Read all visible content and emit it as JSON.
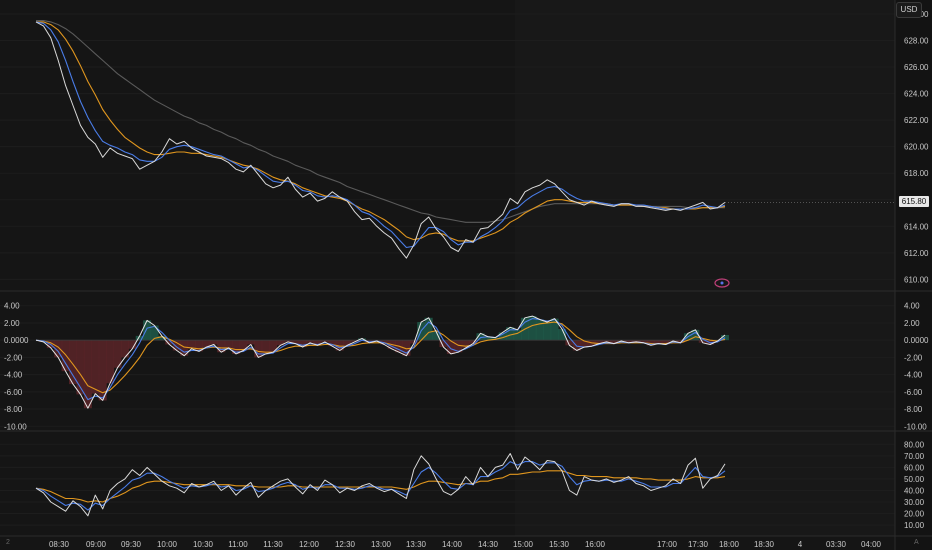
{
  "header": {
    "currency_label": "USD",
    "last_price_label": "615.80",
    "main_title": "",
    "osc1_title": "",
    "osc2_title": ""
  },
  "chart_data": [
    {
      "type": "line",
      "panel": "price",
      "title": "",
      "y_ticks": [
        "630.00",
        "628.00",
        "626.00",
        "624.00",
        "622.00",
        "620.00",
        "618.00",
        "616.00",
        "614.00",
        "612.00",
        "610.00"
      ],
      "ylim": [
        609.5,
        630.6
      ],
      "x_ticks": [
        "08:30",
        "09:00",
        "09:30",
        "10:00",
        "10:30",
        "11:00",
        "11:30",
        "12:00",
        "12:30",
        "13:00",
        "13:30",
        "14:00",
        "14:30",
        "15:00",
        "15:30",
        "16:00",
        "17:00",
        "17:30",
        "18:00",
        "18:30",
        "4",
        "03:30",
        "04:00"
      ],
      "last_price": 615.8,
      "series": [
        {
          "key": "price",
          "color": "#d9d9d9",
          "y": [
            629.4,
            629.1,
            628.2,
            626.5,
            624.6,
            623.1,
            621.6,
            620.7,
            620.2,
            619.2,
            619.9,
            619.5,
            619.3,
            619.1,
            618.3,
            618.6,
            618.9,
            619.6,
            620.6,
            620.2,
            620.4,
            619.9,
            619.6,
            619.3,
            619.2,
            619.1,
            618.8,
            618.3,
            618.1,
            618.6,
            617.9,
            617.2,
            616.9,
            617.1,
            617.7,
            616.8,
            616.2,
            616.5,
            615.9,
            616.1,
            616.6,
            616.2,
            615.9,
            615.1,
            614.5,
            614.6,
            614.0,
            613.5,
            613.1,
            612.3,
            611.6,
            612.6,
            614.2,
            614.7,
            613.8,
            613.2,
            612.4,
            612.1,
            613.0,
            612.8,
            613.8,
            613.9,
            614.4,
            614.9,
            616.1,
            615.7,
            616.6,
            616.9,
            617.1,
            617.5,
            617.2,
            616.6,
            616.0,
            615.8,
            615.6,
            615.9,
            615.7,
            615.6,
            615.5,
            615.7,
            615.7,
            615.5,
            615.5,
            615.4,
            615.3,
            615.2,
            615.3,
            615.2,
            615.4,
            615.6,
            615.8,
            615.3,
            615.4,
            615.8
          ]
        },
        {
          "key": "ema-fast",
          "color": "#4a7de8",
          "y": [
            629.4,
            629.3,
            628.8,
            627.9,
            626.5,
            624.9,
            623.4,
            622.2,
            621.2,
            620.4,
            620.1,
            619.9,
            619.6,
            619.4,
            619.0,
            618.9,
            618.9,
            619.2,
            619.8,
            620.0,
            620.1,
            620.0,
            619.8,
            619.6,
            619.4,
            619.3,
            619.0,
            618.7,
            618.4,
            618.5,
            618.2,
            617.8,
            617.4,
            617.3,
            617.4,
            617.1,
            616.7,
            616.6,
            616.3,
            616.2,
            616.3,
            616.2,
            616.0,
            615.6,
            615.1,
            614.9,
            614.5,
            614.0,
            613.6,
            613.0,
            612.4,
            612.5,
            613.2,
            613.9,
            613.9,
            613.6,
            613.0,
            612.6,
            612.8,
            612.8,
            613.2,
            613.5,
            613.9,
            614.4,
            615.2,
            615.4,
            615.9,
            616.3,
            616.6,
            616.9,
            617.0,
            616.8,
            616.4,
            616.1,
            615.9,
            615.9,
            615.8,
            615.7,
            615.6,
            615.7,
            615.7,
            615.6,
            615.6,
            615.5,
            615.4,
            615.3,
            615.3,
            615.3,
            615.3,
            615.4,
            615.6,
            615.5,
            615.4,
            615.6
          ]
        },
        {
          "key": "ema-mid",
          "color": "#e0961e",
          "y": [
            629.4,
            629.4,
            629.2,
            628.8,
            628.1,
            627.2,
            626.1,
            624.9,
            623.9,
            622.8,
            622.0,
            621.3,
            620.7,
            620.3,
            619.9,
            619.6,
            619.4,
            619.4,
            619.5,
            619.6,
            619.6,
            619.5,
            619.5,
            619.4,
            619.3,
            619.2,
            619.0,
            618.8,
            618.6,
            618.5,
            618.3,
            618.0,
            617.7,
            617.5,
            617.4,
            617.2,
            616.9,
            616.7,
            616.5,
            616.3,
            616.2,
            616.1,
            615.9,
            615.6,
            615.3,
            615.1,
            614.8,
            614.5,
            614.1,
            613.7,
            613.2,
            613.0,
            613.1,
            613.4,
            613.5,
            613.4,
            613.1,
            612.9,
            612.9,
            612.9,
            613.1,
            613.3,
            613.5,
            613.8,
            614.3,
            614.6,
            615.0,
            615.3,
            615.6,
            615.9,
            616.0,
            616.0,
            615.9,
            615.8,
            615.8,
            615.8,
            615.7,
            615.7,
            615.6,
            615.6,
            615.6,
            615.6,
            615.5,
            615.5,
            615.4,
            615.4,
            615.3,
            615.3,
            615.3,
            615.3,
            615.4,
            615.4,
            615.4,
            615.5
          ]
        },
        {
          "key": "ema-slow",
          "color": "#5a5a5a",
          "y": [
            629.5,
            629.5,
            629.4,
            629.2,
            628.9,
            628.5,
            628.0,
            627.5,
            627.0,
            626.5,
            626.0,
            625.5,
            625.1,
            624.7,
            624.3,
            623.9,
            623.5,
            623.2,
            622.9,
            622.6,
            622.3,
            622.1,
            621.8,
            621.6,
            621.3,
            621.1,
            620.8,
            620.6,
            620.3,
            620.1,
            619.8,
            619.6,
            619.3,
            619.1,
            618.9,
            618.6,
            618.4,
            618.2,
            617.9,
            617.7,
            617.5,
            617.3,
            617.0,
            616.8,
            616.6,
            616.4,
            616.2,
            616.0,
            615.8,
            615.6,
            615.4,
            615.2,
            615.0,
            614.9,
            614.7,
            614.6,
            614.5,
            614.4,
            614.3,
            614.3,
            614.3,
            614.3,
            614.4,
            614.5,
            614.7,
            614.9,
            615.1,
            615.3,
            615.5,
            615.6,
            615.7,
            615.7,
            615.7,
            615.7,
            615.7,
            615.7,
            615.7,
            615.6,
            615.6,
            615.6,
            615.6,
            615.6,
            615.6,
            615.5,
            615.5,
            615.5,
            615.5,
            615.5,
            615.4,
            615.4,
            615.4,
            615.4,
            615.4,
            615.4
          ]
        }
      ]
    },
    {
      "type": "area",
      "panel": "oscillator-1",
      "title": "",
      "y_ticks": [
        "4.00",
        "2.00",
        "0.0000",
        "-2.00",
        "-4.00",
        "-6.00",
        "-8.00",
        "-10.00"
      ],
      "ylim": [
        -10.2,
        4.2
      ],
      "series": [
        {
          "key": "osc",
          "color": "#e6e6e6",
          "y": [
            0.0,
            -0.2,
            -0.9,
            -2.0,
            -3.6,
            -5.1,
            -6.3,
            -7.9,
            -6.2,
            -7.0,
            -5.0,
            -3.2,
            -2.0,
            -1.0,
            0.5,
            2.3,
            1.7,
            0.5,
            -0.5,
            -1.2,
            -1.8,
            -1.0,
            -1.3,
            -0.8,
            -0.5,
            -1.4,
            -0.9,
            -1.6,
            -1.2,
            -0.5,
            -2.0,
            -1.6,
            -1.4,
            -0.6,
            -0.2,
            -0.4,
            -0.8,
            -0.3,
            -0.6,
            -0.2,
            -0.7,
            -1.2,
            -0.6,
            -0.2,
            0.2,
            -0.3,
            -0.1,
            -0.5,
            -1.0,
            -1.4,
            -1.8,
            -0.4,
            2.1,
            2.6,
            1.0,
            -0.8,
            -1.6,
            -1.4,
            -0.9,
            -0.4,
            0.8,
            0.4,
            0.3,
            0.9,
            1.5,
            1.2,
            2.6,
            2.8,
            2.4,
            2.1,
            2.5,
            1.3,
            -0.6,
            -1.2,
            -0.8,
            -0.7,
            -0.4,
            -0.2,
            -0.4,
            -0.1,
            -0.3,
            -0.2,
            -0.3,
            -0.6,
            -0.4,
            -0.5,
            -0.1,
            -0.3,
            0.8,
            1.2,
            -0.3,
            -0.5,
            -0.1,
            0.6
          ]
        },
        {
          "key": "signal",
          "color": "#4a7de8",
          "y": [
            0.0,
            -0.1,
            -0.5,
            -1.3,
            -2.7,
            -4.1,
            -5.5,
            -6.9,
            -6.5,
            -6.7,
            -5.5,
            -4.0,
            -2.8,
            -1.7,
            -0.3,
            1.4,
            1.6,
            0.9,
            0.0,
            -0.8,
            -1.4,
            -1.2,
            -1.2,
            -0.9,
            -0.7,
            -1.1,
            -1.0,
            -1.4,
            -1.3,
            -0.8,
            -1.6,
            -1.6,
            -1.5,
            -0.9,
            -0.4,
            -0.4,
            -0.6,
            -0.4,
            -0.5,
            -0.3,
            -0.5,
            -0.9,
            -0.7,
            -0.4,
            -0.0,
            -0.2,
            -0.1,
            -0.3,
            -0.7,
            -1.1,
            -1.5,
            -0.8,
            1.1,
            2.1,
            1.5,
            0.0,
            -1.0,
            -1.3,
            -1.0,
            -0.6,
            0.3,
            0.4,
            0.3,
            0.7,
            1.2,
            1.2,
            2.1,
            2.5,
            2.4,
            2.2,
            2.4,
            1.7,
            0.3,
            -0.7,
            -0.8,
            -0.7,
            -0.5,
            -0.3,
            -0.4,
            -0.2,
            -0.3,
            -0.2,
            -0.3,
            -0.5,
            -0.4,
            -0.5,
            -0.2,
            -0.3,
            0.4,
            0.9,
            0.1,
            -0.3,
            -0.2,
            0.3
          ]
        },
        {
          "key": "signal-slow",
          "color": "#e0961e",
          "y": [
            0.0,
            -0.1,
            -0.3,
            -0.8,
            -1.7,
            -2.8,
            -4.0,
            -5.3,
            -5.7,
            -6.1,
            -5.8,
            -5.0,
            -4.1,
            -3.1,
            -2.0,
            -0.6,
            0.2,
            0.4,
            0.1,
            -0.3,
            -0.8,
            -0.9,
            -1.0,
            -0.9,
            -0.8,
            -0.9,
            -0.9,
            -1.1,
            -1.1,
            -1.0,
            -1.3,
            -1.4,
            -1.4,
            -1.2,
            -0.9,
            -0.7,
            -0.7,
            -0.6,
            -0.6,
            -0.5,
            -0.5,
            -0.7,
            -0.7,
            -0.6,
            -0.4,
            -0.3,
            -0.3,
            -0.3,
            -0.5,
            -0.7,
            -1.0,
            -0.9,
            0.0,
            0.9,
            1.1,
            0.6,
            -0.1,
            -0.6,
            -0.7,
            -0.6,
            -0.2,
            0.0,
            0.1,
            0.3,
            0.6,
            0.8,
            1.3,
            1.7,
            1.9,
            2.0,
            2.1,
            1.9,
            1.2,
            0.4,
            -0.1,
            -0.3,
            -0.4,
            -0.4,
            -0.4,
            -0.3,
            -0.3,
            -0.3,
            -0.3,
            -0.4,
            -0.4,
            -0.4,
            -0.3,
            -0.3,
            0.0,
            0.4,
            0.2,
            0.0,
            -0.1,
            0.1
          ]
        }
      ]
    },
    {
      "type": "line",
      "panel": "oscillator-2",
      "title": "",
      "y_ticks": [
        "80.00",
        "70.00",
        "60.00",
        "50.00",
        "40.00",
        "30.00",
        "20.00",
        "10.00"
      ],
      "ylim": [
        4,
        82
      ],
      "series": [
        {
          "key": "rsi",
          "color": "#d9d9d9",
          "y": [
            42,
            38,
            30,
            26,
            22,
            31,
            26,
            18,
            36,
            24,
            40,
            46,
            50,
            58,
            53,
            60,
            54,
            48,
            44,
            42,
            38,
            46,
            43,
            45,
            48,
            40,
            44,
            36,
            42,
            47,
            34,
            40,
            44,
            48,
            50,
            43,
            37,
            45,
            40,
            49,
            45,
            38,
            42,
            40,
            44,
            46,
            42,
            39,
            41,
            37,
            33,
            58,
            70,
            63,
            50,
            39,
            36,
            41,
            52,
            45,
            60,
            52,
            60,
            62,
            72,
            58,
            69,
            64,
            58,
            66,
            65,
            57,
            40,
            36,
            52,
            49,
            48,
            50,
            47,
            49,
            52,
            46,
            44,
            40,
            42,
            44,
            50,
            46,
            62,
            68,
            42,
            50,
            53,
            63
          ]
        },
        {
          "key": "rsi-fast-ma",
          "color": "#4a7de8",
          "y": [
            42,
            40,
            35,
            31,
            27,
            29,
            28,
            23,
            29,
            27,
            33,
            38,
            43,
            49,
            51,
            55,
            55,
            52,
            48,
            45,
            42,
            44,
            43,
            44,
            46,
            43,
            44,
            40,
            41,
            44,
            39,
            40,
            42,
            45,
            47,
            45,
            41,
            43,
            42,
            45,
            45,
            42,
            42,
            41,
            42,
            44,
            43,
            41,
            41,
            39,
            36,
            46,
            56,
            60,
            55,
            48,
            42,
            41,
            46,
            45,
            52,
            52,
            56,
            59,
            65,
            62,
            65,
            65,
            62,
            64,
            64,
            61,
            52,
            45,
            48,
            49,
            48,
            49,
            48,
            48,
            50,
            48,
            46,
            43,
            43,
            43,
            46,
            46,
            53,
            60,
            52,
            51,
            52,
            57
          ]
        },
        {
          "key": "rsi-slow-ma",
          "color": "#e0961e",
          "y": [
            42,
            41,
            39,
            36,
            33,
            33,
            32,
            30,
            31,
            30,
            33,
            35,
            38,
            42,
            44,
            47,
            48,
            48,
            47,
            46,
            45,
            45,
            45,
            45,
            45,
            45,
            45,
            44,
            44,
            44,
            43,
            43,
            43,
            43,
            44,
            44,
            43,
            43,
            43,
            43,
            43,
            43,
            43,
            43,
            43,
            43,
            43,
            43,
            43,
            42,
            41,
            43,
            46,
            48,
            48,
            47,
            46,
            45,
            46,
            46,
            48,
            48,
            50,
            51,
            54,
            54,
            55,
            56,
            56,
            57,
            57,
            57,
            55,
            53,
            53,
            52,
            52,
            52,
            51,
            51,
            51,
            51,
            50,
            50,
            49,
            49,
            49,
            49,
            50,
            52,
            51,
            51,
            51,
            52
          ]
        }
      ]
    }
  ]
}
